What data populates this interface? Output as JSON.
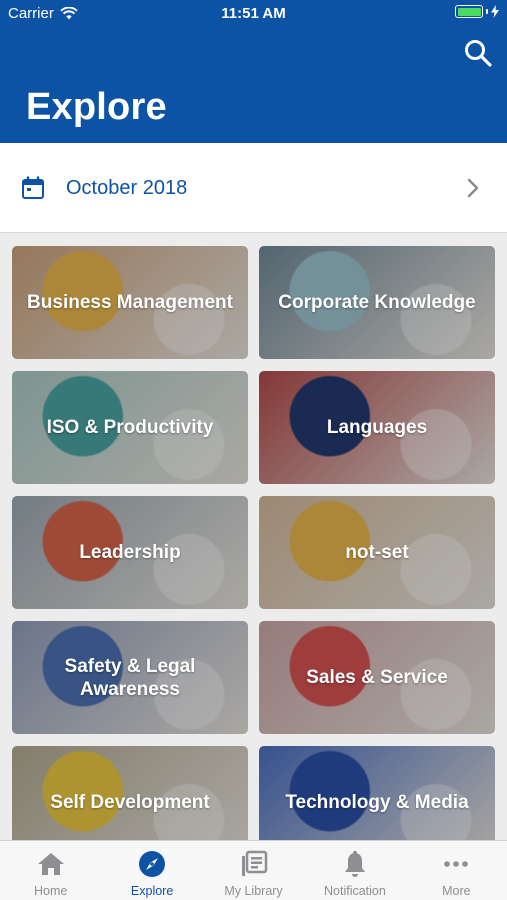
{
  "status": {
    "carrier": "Carrier",
    "time": "11:51 AM",
    "battery_level": 1.0
  },
  "header": {
    "title": "Explore"
  },
  "date_bar": {
    "label": "October 2018"
  },
  "categories": [
    {
      "label": "Business Management",
      "bg": "#c9a07a",
      "accent": "#e6b44c"
    },
    {
      "label": "Corporate Knowledge",
      "bg": "#6f8796",
      "accent": "#9bc0cc"
    },
    {
      "label": "ISO & Productivity",
      "bg": "#a8c7c2",
      "accent": "#4aa0a0"
    },
    {
      "label": "Languages",
      "bg": "#b04a4a",
      "accent": "#24386e"
    },
    {
      "label": "Leadership",
      "bg": "#9aa6b0",
      "accent": "#d4634a"
    },
    {
      "label": "not-set",
      "bg": "#d1b79a",
      "accent": "#e6b44c"
    },
    {
      "label": "Safety & Legal Awareness",
      "bg": "#8f9cb8",
      "accent": "#4b6fb0"
    },
    {
      "label": "Sales & Service",
      "bg": "#c9a5a5",
      "accent": "#d45050"
    },
    {
      "label": "Self Development",
      "bg": "#b0a890",
      "accent": "#e8c640"
    },
    {
      "label": "Technology & Media",
      "bg": "#4a6ec0",
      "accent": "#2b4fa5"
    }
  ],
  "tabs": [
    {
      "label": "Home",
      "icon": "home-icon"
    },
    {
      "label": "Explore",
      "icon": "compass-icon"
    },
    {
      "label": "My Library",
      "icon": "library-icon"
    },
    {
      "label": "Notification",
      "icon": "bell-icon"
    },
    {
      "label": "More",
      "icon": "more-icon"
    }
  ],
  "active_tab": "Explore",
  "colors": {
    "brand": "#0d53a5",
    "tab_inactive": "#8e8e93",
    "battery": "#4cd964"
  }
}
